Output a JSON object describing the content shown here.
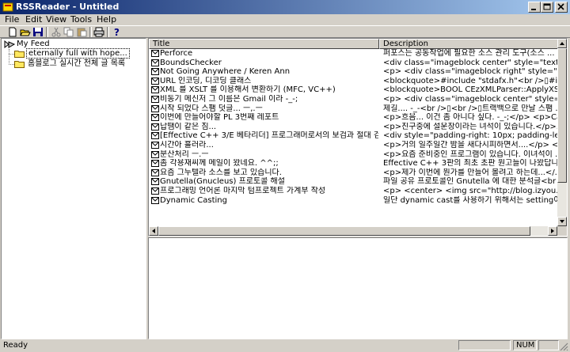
{
  "window": {
    "title": "RSSReader - Untitled"
  },
  "menu": {
    "file": "File",
    "edit": "Edit",
    "view": "View",
    "tools": "Tools",
    "help": "Help"
  },
  "toolbar": {
    "buttons": [
      "new-icon",
      "open-icon",
      "save-icon",
      "cut-icon",
      "copy-icon",
      "paste-icon",
      "print-icon",
      "help-icon"
    ]
  },
  "tree": {
    "root": "My Feed",
    "items": [
      "eternally full with hope...",
      "홈블로그 실시간 전체 글 목록"
    ]
  },
  "list": {
    "columns": {
      "title": "Title",
      "description": "Description"
    },
    "rows": [
      {
        "title": "Perforce",
        "description": "퍼포스는 공동작업에 필요한 소스 관리 도구(소스 ..."
      },
      {
        "title": "BoundsChecker",
        "description": "<div class=\"imageblock center\" style=\"text-align:..."
      },
      {
        "title": "Not Going Anywhere / Keren Ann",
        "description": "<p> <div class=\"imageblock right\" style=\"float: rig..."
      },
      {
        "title": "URL 인코딩, 디코딩 클래스",
        "description": "<blockquote>#include \"stdafx.h\"<br />▯#include ..."
      },
      {
        "title": "XML 를 XSLT 를 이용해서 변환하기 (MFC, VC++)",
        "description": "<blockquote>BOOL CEzXMLParser::ApplyXSLT..."
      },
      {
        "title": "비동기 메신저 그 이름은 Gmail 이라 -_-;",
        "description": "<p> <div class=\"imageblock center\" style=\"text-a..."
      },
      {
        "title": "시작 되었다 스팸 덧글... ㅡ,.ㅡ",
        "description": "제길.... -_-<br />▯<br />▯트랙백으로 만날 스팸 ..."
      },
      {
        "title": "이번에 만들어야할 PL 3번째 레포트",
        "description": "<p>흐음... 이건 좀 아니다 싶다. -_-;</p> <p>Call..."
      },
      {
        "title": "납땜이 같은 짐...",
        "description": "<p>친구중에 설운창이라는 녀석이 있습니다.</p>..."
      },
      {
        "title": "[Effective C++ 3/E 베타리더] 프로그래머로서의 보검과 절대 검법",
        "description": "<div style=\"padding-right: 10px; padding-left: 10p..."
      },
      {
        "title": "시간아 흘러라...",
        "description": "<p>거의 일주일간 밤을 새다시피하면서....</p> <p>..."
      },
      {
        "title": "분산처리 ㅡ.ㅡ",
        "description": "<p>요즘 준비중인 프로그램이 있습니다. 이녀석이 ..."
      },
      {
        "title": "좀 각용재씨께 메일이 왔네요. ^^;;",
        "description": "Effective C++ 3판의 최초 초판 원고들이 나왔답니..."
      },
      {
        "title": "요즘 그누텔라 소스를 보고 있습니다.",
        "description": "<p>제가 이번에 뭔가를 만들어 볼려고 하는데...</..."
      },
      {
        "title": "Gnutella(Gnucleus) 프로토콜 해설",
        "description": "파일 공유 프로토콜인 Gnutella 에 대한 분석글<br ..."
      },
      {
        "title": "프로그래밍 언어론 마지막 텀프로젝트 가계부 작성",
        "description": "<p> <center> <img src=\"http://blog.izyou.net/im..."
      },
      {
        "title": "Dynamic Casting",
        "description": "일단 dynamic cast를 사용하기 위해서는 setting이..."
      }
    ]
  },
  "status": {
    "text": "Ready",
    "num": "NUM"
  }
}
